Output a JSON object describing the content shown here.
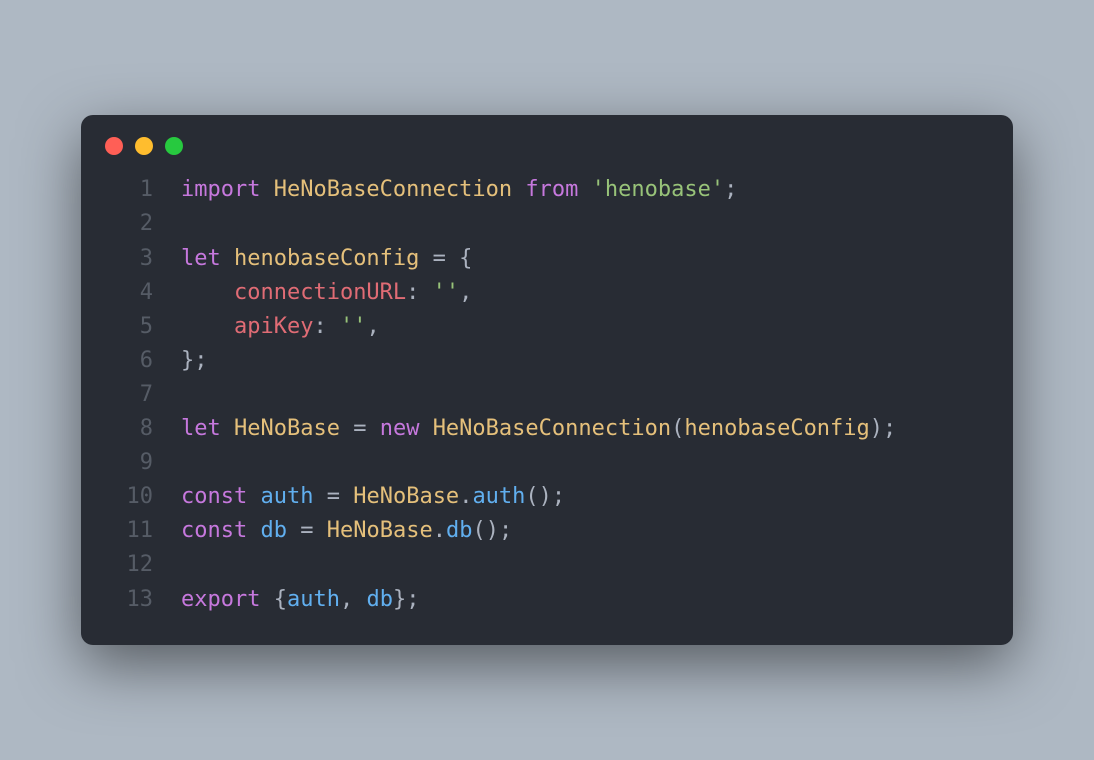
{
  "traffic_lights": [
    "red",
    "yellow",
    "green"
  ],
  "colors": {
    "bg": "#aeb8c3",
    "window": "#282c34",
    "red": "#ff5f56",
    "yellow": "#ffbd2e",
    "green": "#27c93f",
    "keyword": "#c678dd",
    "ident": "#e5c07b",
    "prop": "#e06c75",
    "var": "#61afef",
    "str": "#98c379",
    "punc": "#abb2bf",
    "lineno": "#565c66"
  },
  "code": {
    "language": "javascript",
    "lines": [
      {
        "n": "1",
        "tokens": [
          {
            "t": "import ",
            "c": "keyword"
          },
          {
            "t": "HeNoBaseConnection ",
            "c": "ident"
          },
          {
            "t": "from ",
            "c": "keyword"
          },
          {
            "t": "'henobase'",
            "c": "str"
          },
          {
            "t": ";",
            "c": "punc"
          }
        ]
      },
      {
        "n": "2",
        "tokens": []
      },
      {
        "n": "3",
        "tokens": [
          {
            "t": "let ",
            "c": "keyword"
          },
          {
            "t": "henobaseConfig ",
            "c": "ident"
          },
          {
            "t": "= {",
            "c": "punc"
          }
        ]
      },
      {
        "n": "4",
        "tokens": [
          {
            "t": "    ",
            "c": "plain"
          },
          {
            "t": "connectionURL",
            "c": "prop"
          },
          {
            "t": ": ",
            "c": "punc"
          },
          {
            "t": "''",
            "c": "str"
          },
          {
            "t": ",",
            "c": "punc"
          }
        ]
      },
      {
        "n": "5",
        "tokens": [
          {
            "t": "    ",
            "c": "plain"
          },
          {
            "t": "apiKey",
            "c": "prop"
          },
          {
            "t": ": ",
            "c": "punc"
          },
          {
            "t": "''",
            "c": "str"
          },
          {
            "t": ",",
            "c": "punc"
          }
        ]
      },
      {
        "n": "6",
        "tokens": [
          {
            "t": "};",
            "c": "punc"
          }
        ]
      },
      {
        "n": "7",
        "tokens": []
      },
      {
        "n": "8",
        "tokens": [
          {
            "t": "let ",
            "c": "keyword"
          },
          {
            "t": "HeNoBase ",
            "c": "ident"
          },
          {
            "t": "= ",
            "c": "punc"
          },
          {
            "t": "new ",
            "c": "keyword"
          },
          {
            "t": "HeNoBaseConnection",
            "c": "ident"
          },
          {
            "t": "(",
            "c": "punc"
          },
          {
            "t": "henobaseConfig",
            "c": "ident"
          },
          {
            "t": ");",
            "c": "punc"
          }
        ]
      },
      {
        "n": "9",
        "tokens": []
      },
      {
        "n": "10",
        "tokens": [
          {
            "t": "const ",
            "c": "keyword"
          },
          {
            "t": "auth ",
            "c": "var"
          },
          {
            "t": "= ",
            "c": "punc"
          },
          {
            "t": "HeNoBase",
            "c": "ident"
          },
          {
            "t": ".",
            "c": "punc"
          },
          {
            "t": "auth",
            "c": "var"
          },
          {
            "t": "();",
            "c": "punc"
          }
        ]
      },
      {
        "n": "11",
        "tokens": [
          {
            "t": "const ",
            "c": "keyword"
          },
          {
            "t": "db ",
            "c": "var"
          },
          {
            "t": "= ",
            "c": "punc"
          },
          {
            "t": "HeNoBase",
            "c": "ident"
          },
          {
            "t": ".",
            "c": "punc"
          },
          {
            "t": "db",
            "c": "var"
          },
          {
            "t": "();",
            "c": "punc"
          }
        ]
      },
      {
        "n": "12",
        "tokens": []
      },
      {
        "n": "13",
        "tokens": [
          {
            "t": "export ",
            "c": "keyword"
          },
          {
            "t": "{",
            "c": "punc"
          },
          {
            "t": "auth",
            "c": "var"
          },
          {
            "t": ", ",
            "c": "punc"
          },
          {
            "t": "db",
            "c": "var"
          },
          {
            "t": "};",
            "c": "punc"
          }
        ]
      }
    ]
  }
}
